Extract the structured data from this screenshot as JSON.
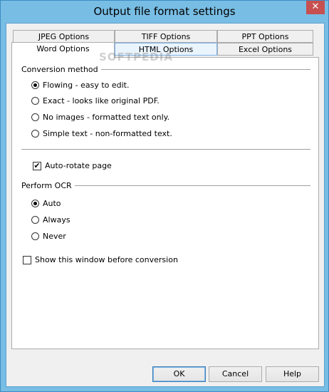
{
  "window": {
    "title": "Output file format settings",
    "close_glyph": "✕"
  },
  "watermark": "SOFTPEDIA",
  "tabs": {
    "row1": [
      {
        "label": "JPEG Options"
      },
      {
        "label": "TIFF Options"
      },
      {
        "label": "PPT Options"
      }
    ],
    "row2": [
      {
        "label": "Word Options",
        "active": true
      },
      {
        "label": "HTML Options",
        "highlighted": true
      },
      {
        "label": "Excel Options"
      }
    ]
  },
  "conversion": {
    "label": "Conversion method",
    "options": [
      {
        "label": "Flowing - easy to edit.",
        "selected": true
      },
      {
        "label": "Exact - looks like original PDF.",
        "selected": false
      },
      {
        "label": "No images - formatted text only.",
        "selected": false
      },
      {
        "label": "Simple text - non-formatted text.",
        "selected": false
      }
    ]
  },
  "auto_rotate": {
    "label": "Auto-rotate page",
    "checked": true
  },
  "ocr": {
    "label": "Perform OCR",
    "options": [
      {
        "label": "Auto",
        "selected": true
      },
      {
        "label": "Always",
        "selected": false
      },
      {
        "label": "Never",
        "selected": false
      }
    ]
  },
  "show_window": {
    "label": "Show this window before conversion",
    "checked": false
  },
  "buttons": {
    "ok": "OK",
    "cancel": "Cancel",
    "help": "Help"
  },
  "colors": {
    "frame": "#78bde4",
    "close": "#c75050",
    "panel": "#ffffff",
    "dialog": "#f0f0f0"
  }
}
